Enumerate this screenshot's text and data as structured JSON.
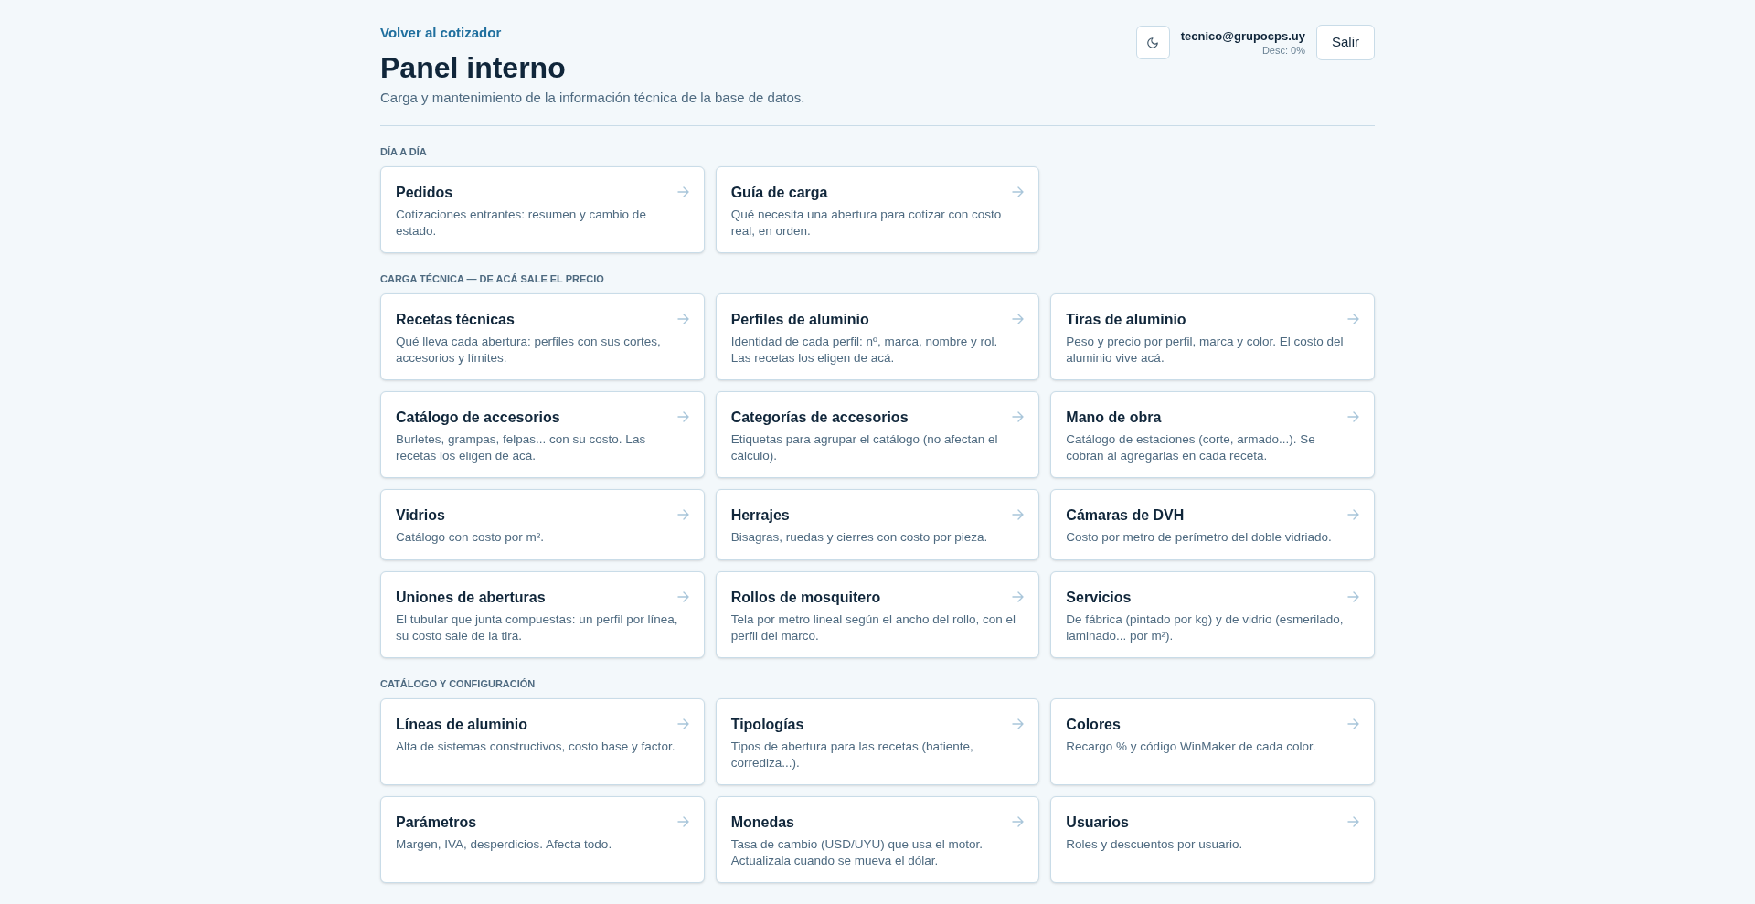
{
  "header": {
    "back_link": "Volver al cotizador",
    "title": "Panel interno",
    "subtitle": "Carga y mantenimiento de la información técnica de la base de datos.",
    "user_email": "tecnico@grupocps.uy",
    "user_discount": "Desc: 0%",
    "logout_button": "Salir"
  },
  "sections": [
    {
      "heading": "DÍA A DÍA",
      "cards": [
        {
          "title": "Pedidos",
          "description": "Cotizaciones entrantes: resumen y cambio de estado."
        },
        {
          "title": "Guía de carga",
          "description": "Qué necesita una abertura para cotizar con costo real, en orden."
        }
      ]
    },
    {
      "heading": "CARGA TÉCNICA — DE ACÁ SALE EL PRECIO",
      "cards": [
        {
          "title": "Recetas técnicas",
          "description": "Qué lleva cada abertura: perfiles con sus cortes, accesorios y límites."
        },
        {
          "title": "Perfiles de aluminio",
          "description": "Identidad de cada perfil: nº, marca, nombre y rol. Las recetas los eligen de acá."
        },
        {
          "title": "Tiras de aluminio",
          "description": "Peso y precio por perfil, marca y color. El costo del aluminio vive acá."
        },
        {
          "title": "Catálogo de accesorios",
          "description": "Burletes, grampas, felpas... con su costo. Las recetas los eligen de acá."
        },
        {
          "title": "Categorías de accesorios",
          "description": "Etiquetas para agrupar el catálogo (no afectan el cálculo)."
        },
        {
          "title": "Mano de obra",
          "description": "Catálogo de estaciones (corte, armado...). Se cobran al agregarlas en cada receta."
        },
        {
          "title": "Vidrios",
          "description": "Catálogo con costo por m²."
        },
        {
          "title": "Herrajes",
          "description": "Bisagras, ruedas y cierres con costo por pieza."
        },
        {
          "title": "Cámaras de DVH",
          "description": "Costo por metro de perímetro del doble vidriado."
        },
        {
          "title": "Uniones de aberturas",
          "description": "El tubular que junta compuestas: un perfil por línea, su costo sale de la tira."
        },
        {
          "title": "Rollos de mosquitero",
          "description": "Tela por metro lineal según el ancho del rollo, con el perfil del marco."
        },
        {
          "title": "Servicios",
          "description": "De fábrica (pintado por kg) y de vidrio (esmerilado, laminado... por m²)."
        }
      ]
    },
    {
      "heading": "CATÁLOGO Y CONFIGURACIÓN",
      "cards": [
        {
          "title": "Líneas de aluminio",
          "description": "Alta de sistemas constructivos, costo base y factor."
        },
        {
          "title": "Tipologías",
          "description": "Tipos de abertura para las recetas (batiente, corrediza...)."
        },
        {
          "title": "Colores",
          "description": "Recargo % y código WinMaker de cada color."
        },
        {
          "title": "Parámetros",
          "description": "Margen, IVA, desperdicios. Afecta todo."
        },
        {
          "title": "Monedas",
          "description": "Tasa de cambio (USD/UYU) que usa el motor. Actualizala cuando se mueva el dólar."
        },
        {
          "title": "Usuarios",
          "description": "Roles y descuentos por usuario."
        }
      ]
    }
  ]
}
